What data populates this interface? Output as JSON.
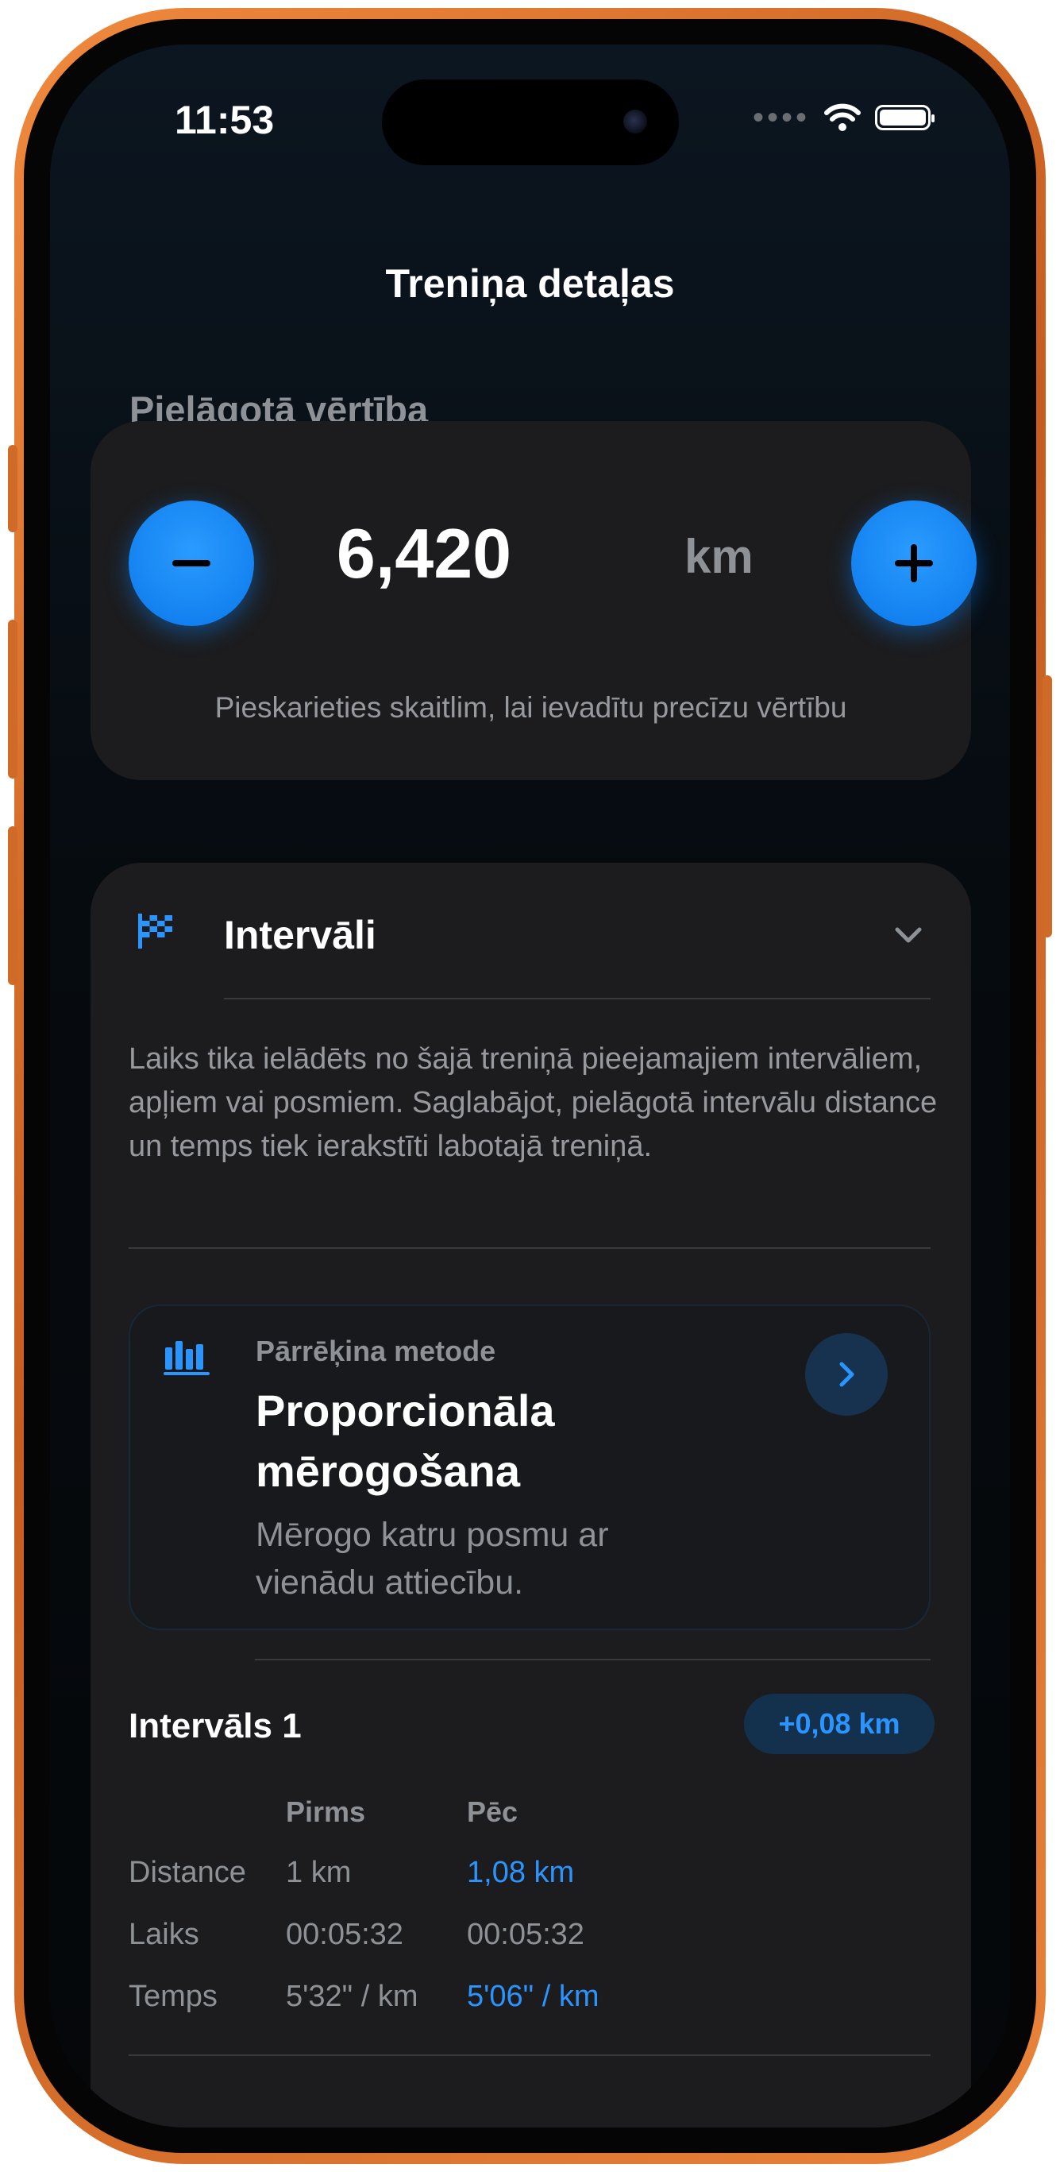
{
  "status_bar": {
    "time": "11:53",
    "signal": "signal-dots-icon",
    "wifi": "wifi-icon",
    "battery": "battery-icon"
  },
  "nav": {
    "title": "Treniņa detaļas"
  },
  "adjusted_value": {
    "section_label": "Pielāgotā vērtība",
    "value": "6,420",
    "unit": "km",
    "hint": "Pieskarieties skaitlim, lai ievadītu precīzu vērtību",
    "minus_icon": "minus-icon",
    "plus_icon": "plus-icon"
  },
  "intervals": {
    "title": "Intervāli",
    "icon": "checkered-flag-icon",
    "expanded": true,
    "description": "Laiks tika ielādēts no šajā treniņā pieejamajiem intervāliem, apļiem vai posmiem. Saglabājot, pielāgotā intervālu distance un temps tiek ierakstīti labotajā treniņā.",
    "method": {
      "label": "Pārrēķina metode",
      "title": "Proporcionāla mērogošana",
      "description": "Mērogo katru posmu ar vienādu attiecību.",
      "icon": "bar-chart-icon"
    },
    "items": [
      {
        "title": "Intervāls 1",
        "delta": "+0,08 km",
        "columns": [
          "Pirms",
          "Pēc"
        ],
        "rows": [
          {
            "label": "Distance",
            "before": "1 km",
            "after": "1,08 km"
          },
          {
            "label": "Laiks",
            "before": "00:05:32",
            "after": "00:05:32"
          },
          {
            "label": "Temps",
            "before": "5'32\" / km",
            "after": "5'06\" / km"
          }
        ]
      }
    ]
  },
  "colors": {
    "accent": "#0A84FF",
    "card": "#1C1C1E",
    "frame": "#E47A33"
  }
}
